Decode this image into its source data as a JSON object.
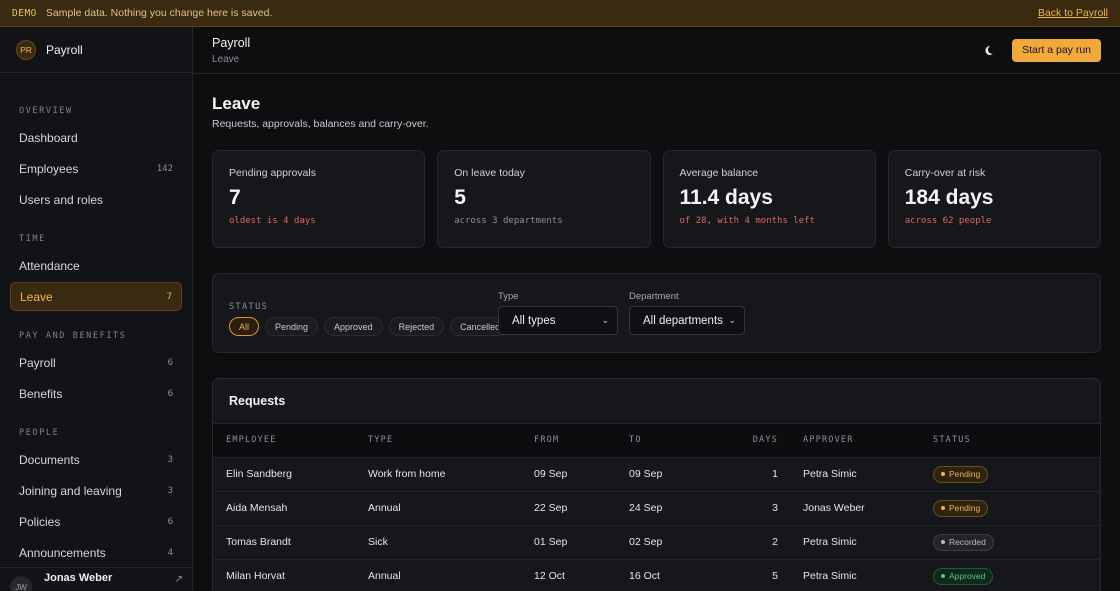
{
  "banner": {
    "tag": "DEMO",
    "message": "Sample data. Nothing you change here is saved.",
    "back_link": "Back to Payroll"
  },
  "brand": {
    "initials": "PR",
    "name": "Payroll"
  },
  "sidebar": {
    "sections": [
      {
        "title": "OVERVIEW",
        "items": [
          {
            "label": "Dashboard",
            "count": ""
          },
          {
            "label": "Employees",
            "count": "142"
          },
          {
            "label": "Users and roles",
            "count": ""
          }
        ]
      },
      {
        "title": "TIME",
        "items": [
          {
            "label": "Attendance",
            "count": ""
          },
          {
            "label": "Leave",
            "count": "7",
            "active": true
          }
        ]
      },
      {
        "title": "PAY AND BENEFITS",
        "items": [
          {
            "label": "Payroll",
            "count": "6"
          },
          {
            "label": "Benefits",
            "count": "6"
          }
        ]
      },
      {
        "title": "PEOPLE",
        "items": [
          {
            "label": "Documents",
            "count": "3"
          },
          {
            "label": "Joining and leaving",
            "count": "3"
          },
          {
            "label": "Policies",
            "count": "6"
          },
          {
            "label": "Announcements",
            "count": "4"
          }
        ]
      }
    ],
    "user": {
      "initials": "JW",
      "name": "Jonas Weber"
    }
  },
  "topbar": {
    "title": "Payroll",
    "subtitle": "Leave",
    "theme_icon": "moon-icon",
    "primary_button": "Start a pay run"
  },
  "page": {
    "title": "Leave",
    "subtitle": "Requests, approvals, balances and carry-over."
  },
  "stats": [
    {
      "label": "Pending approvals",
      "value": "7",
      "note": "oldest is 4 days",
      "warn": true
    },
    {
      "label": "On leave today",
      "value": "5",
      "note": "across 3 departments",
      "warn": false
    },
    {
      "label": "Average balance",
      "value": "11.4 days",
      "note": "of 28, with 4 months left",
      "warn": true
    },
    {
      "label": "Carry-over at risk",
      "value": "184 days",
      "note": "across 62 people",
      "warn": true
    }
  ],
  "filters": {
    "status_title": "STATUS",
    "chips": [
      "All",
      "Pending",
      "Approved",
      "Rejected",
      "Cancelled"
    ],
    "active_chip": "All",
    "type": {
      "label": "Type",
      "value": "All types"
    },
    "department": {
      "label": "Department",
      "value": "All departments"
    }
  },
  "requests": {
    "title": "Requests",
    "columns": [
      "EMPLOYEE",
      "TYPE",
      "FROM",
      "TO",
      "DAYS",
      "APPROVER",
      "STATUS"
    ],
    "rows": [
      {
        "employee": "Elin Sandberg",
        "type": "Work from home",
        "from": "09 Sep",
        "to": "09 Sep",
        "days": "1",
        "approver": "Petra Simic",
        "status": "Pending"
      },
      {
        "employee": "Aida Mensah",
        "type": "Annual",
        "from": "22 Sep",
        "to": "24 Sep",
        "days": "3",
        "approver": "Jonas Weber",
        "status": "Pending"
      },
      {
        "employee": "Tomas Brandt",
        "type": "Sick",
        "from": "01 Sep",
        "to": "02 Sep",
        "days": "2",
        "approver": "Petra Simic",
        "status": "Recorded"
      },
      {
        "employee": "Milan Horvat",
        "type": "Annual",
        "from": "12 Oct",
        "to": "16 Oct",
        "days": "5",
        "approver": "Petra Simic",
        "status": "Approved"
      }
    ]
  },
  "colors": {
    "accent": "#f0a93a",
    "warn": "#e0646a",
    "success": "#4ccc84"
  }
}
